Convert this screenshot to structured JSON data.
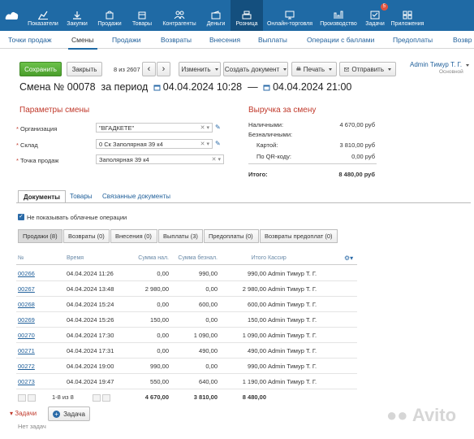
{
  "topnav": {
    "items": [
      {
        "label": "Показатели",
        "icon": "chart-icon"
      },
      {
        "label": "Закупки",
        "icon": "download-icon"
      },
      {
        "label": "Продажи",
        "icon": "bag-icon"
      },
      {
        "label": "Товары",
        "icon": "box-icon"
      },
      {
        "label": "Контрагенты",
        "icon": "people-icon"
      },
      {
        "label": "Деньги",
        "icon": "wallet-icon"
      },
      {
        "label": "Розница",
        "icon": "cash-register-icon"
      },
      {
        "label": "Онлайн-торговля",
        "icon": "online-store-icon"
      },
      {
        "label": "Производство",
        "icon": "factory-icon"
      },
      {
        "label": "Задачи",
        "icon": "tasks-icon",
        "badge": "5"
      },
      {
        "label": "Приложения",
        "icon": "apps-icon"
      }
    ],
    "active": "Розница"
  },
  "subnav": {
    "items": [
      "Точки продаж",
      "Смены",
      "Продажи",
      "Возвраты",
      "Внесения",
      "Выплаты",
      "Операции с баллами",
      "Предоплаты",
      "Возвр"
    ],
    "active": "Смены"
  },
  "toolbar": {
    "save": "Сохранить",
    "close": "Закрыть",
    "counter": "8 из 2607",
    "change": "Изменить",
    "create_doc": "Создать документ",
    "print": "Печать",
    "send": "Отправить"
  },
  "user": {
    "name": "Admin Тимур Т. Г.",
    "role": "Основной"
  },
  "header": {
    "prefix": "Смена №",
    "number": "00078",
    "period_label": "за период",
    "from": "04.04.2024 10:28",
    "dash": "—",
    "to": "04.04.2024 21:00"
  },
  "params": {
    "title": "Параметры смены",
    "org_label": "Организация",
    "org_value": "\"ВГАДКЕТЕ\"",
    "warehouse_label": "Склад",
    "warehouse_value": "0 Ск Заполярная 39 к4",
    "point_label": "Точка продаж",
    "point_value": "Заполярная 39 к4"
  },
  "revenue": {
    "title": "Выручка за смену",
    "cash_label": "Наличными:",
    "cash_value": "4 670,00 руб",
    "noncash_label": "Безналичными:",
    "card_label": "Картой:",
    "card_value": "3 810,00 руб",
    "qr_label": "По QR-коду:",
    "qr_value": "0,00 руб",
    "total_label": "Итого:",
    "total_value": "8 480,00 руб"
  },
  "doc_tabs": [
    "Документы",
    "Товары",
    "Связанные документы"
  ],
  "hide_cloud": "Не показывать облачные операции",
  "segments": [
    "Продажи (8)",
    "Возвраты (0)",
    "Внесения (0)",
    "Выплаты (3)",
    "Предоплаты (0)",
    "Возвраты предоплат (0)"
  ],
  "table": {
    "columns": [
      "№",
      "Время",
      "Сумма нал.",
      "Сумма безнал.",
      "Итого",
      "Кассир"
    ],
    "rows": [
      {
        "num": "00266",
        "time": "04.04.2024 11:26",
        "cash": "0,00",
        "noncash": "990,00",
        "total": "990,00",
        "cashier": "Admin Тимур Т. Г."
      },
      {
        "num": "00267",
        "time": "04.04.2024 13:48",
        "cash": "2 980,00",
        "noncash": "0,00",
        "total": "2 980,00",
        "cashier": "Admin Тимур Т. Г."
      },
      {
        "num": "00268",
        "time": "04.04.2024 15:24",
        "cash": "0,00",
        "noncash": "600,00",
        "total": "600,00",
        "cashier": "Admin Тимур Т. Г."
      },
      {
        "num": "00269",
        "time": "04.04.2024 15:26",
        "cash": "150,00",
        "noncash": "0,00",
        "total": "150,00",
        "cashier": "Admin Тимур Т. Г."
      },
      {
        "num": "00270",
        "time": "04.04.2024 17:30",
        "cash": "0,00",
        "noncash": "1 090,00",
        "total": "1 090,00",
        "cashier": "Admin Тимур Т. Г."
      },
      {
        "num": "00271",
        "time": "04.04.2024 17:31",
        "cash": "0,00",
        "noncash": "490,00",
        "total": "490,00",
        "cashier": "Admin Тимур Т. Г."
      },
      {
        "num": "00272",
        "time": "04.04.2024 19:00",
        "cash": "990,00",
        "noncash": "0,00",
        "total": "990,00",
        "cashier": "Admin Тимур Т. Г."
      },
      {
        "num": "00273",
        "time": "04.04.2024 19:47",
        "cash": "550,00",
        "noncash": "640,00",
        "total": "1 190,00",
        "cashier": "Admin Тимур Т. Г."
      }
    ],
    "footer": {
      "range": "1-8 из 8",
      "cash": "4 670,00",
      "noncash": "3 810,00",
      "total": "8 480,00"
    }
  },
  "tasks": {
    "label": "Задачи",
    "add": "Задача",
    "empty": "Нет задач"
  },
  "watermark": "Avito"
}
